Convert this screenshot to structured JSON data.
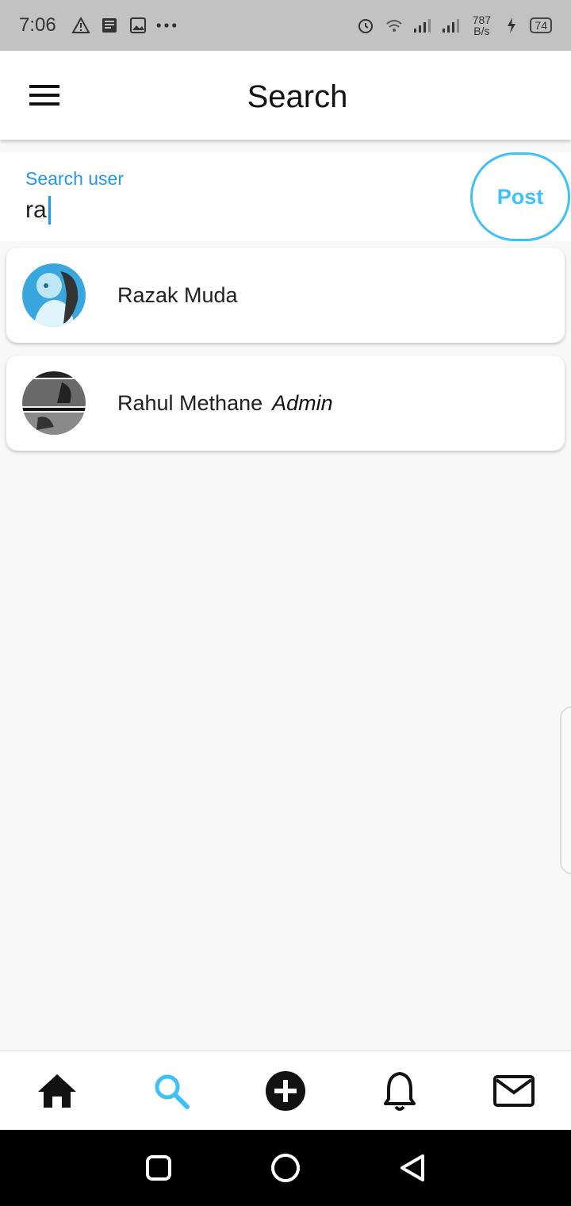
{
  "status_bar": {
    "time": "7:06",
    "net_speed_value": "787",
    "net_speed_unit": "B/s",
    "battery": "74"
  },
  "app_bar": {
    "title": "Search",
    "menu_icon": "hamburger-menu-icon"
  },
  "search": {
    "label": "Search user",
    "value": "ra",
    "post_label": "Post"
  },
  "results": [
    {
      "name": "Razak Muda",
      "role": "",
      "avatar_color": "#3aa6e0"
    },
    {
      "name": "Rahul Methane",
      "role": "Admin",
      "avatar_color": "#555555"
    }
  ],
  "bottom_nav": {
    "items": [
      "home-icon",
      "search-icon",
      "add-circle-icon",
      "bell-icon",
      "mail-icon"
    ],
    "active": "search-icon",
    "active_color": "#40c0f8"
  },
  "system_nav": [
    "recents-square-icon",
    "home-circle-icon",
    "back-triangle-icon"
  ]
}
